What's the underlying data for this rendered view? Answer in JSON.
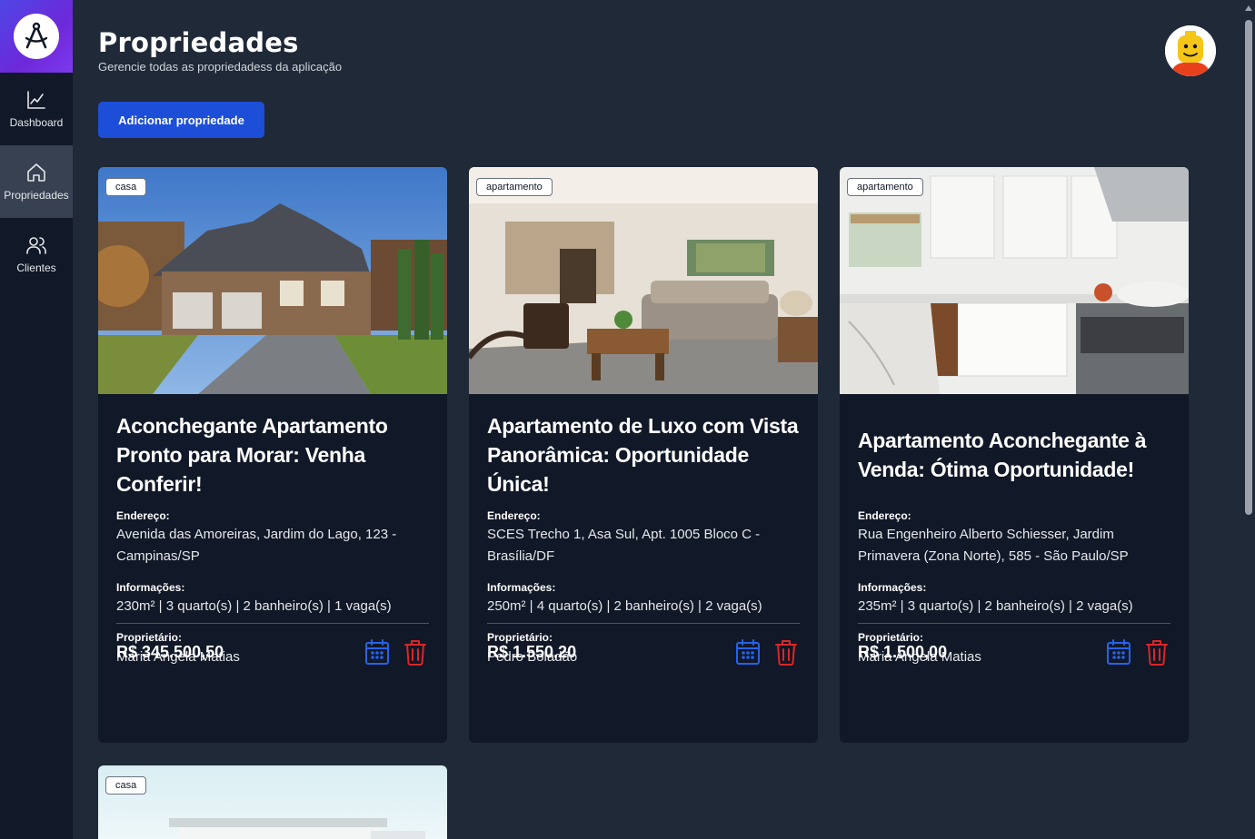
{
  "sidebar": {
    "items": [
      {
        "label": "Dashboard",
        "icon": "chart-line-icon"
      },
      {
        "label": "Propriedades",
        "icon": "home-icon"
      },
      {
        "label": "Clientes",
        "icon": "users-icon"
      }
    ]
  },
  "header": {
    "title": "Propriedades",
    "subtitle": "Gerencie todas as propriedadess da aplicação"
  },
  "actions": {
    "add_label": "Adicionar propriedade"
  },
  "labels": {
    "address": "Endereço:",
    "info": "Informações:",
    "owner": "Proprietário:"
  },
  "properties": [
    {
      "type": "casa",
      "title": "Aconchegante Apartamento Pronto para Morar: Venha Conferir!",
      "address": "Avenida das Amoreiras, Jardim do Lago, 123 - Campinas/SP",
      "info": "230m² | 3 quarto(s) | 2 banheiro(s) | 1 vaga(s)",
      "owner": "Maria Angela Matias",
      "price": "R$ 345.500,50"
    },
    {
      "type": "apartamento",
      "title": "Apartamento de Luxo com Vista Panorâmica: Oportunidade Única!",
      "address": "SCES Trecho 1, Asa Sul, Apt. 1005 Bloco C - Brasília/DF",
      "info": "250m² | 4 quarto(s) | 2 banheiro(s) | 2 vaga(s)",
      "owner": "Pedro Boladão",
      "price": "R$ 1.550,20"
    },
    {
      "type": "apartamento",
      "title": "Apartamento Aconchegante à Venda: Ótima Oportunidade!",
      "address": "Rua Engenheiro Alberto Schiesser, Jardim Primavera (Zona Norte), 585 - São Paulo/SP",
      "info": "235m² | 3 quarto(s) | 2 banheiro(s) | 2 vaga(s)",
      "owner": "Maria Angela Matias",
      "price": "R$ 1.500,00"
    },
    {
      "type": "casa"
    }
  ],
  "colors": {
    "background": "#1f2937",
    "sidebar": "#111827",
    "card": "#111827",
    "primary": "#1d4ed8",
    "schedule_icon": "#2563eb",
    "delete_icon": "#dc2626"
  }
}
